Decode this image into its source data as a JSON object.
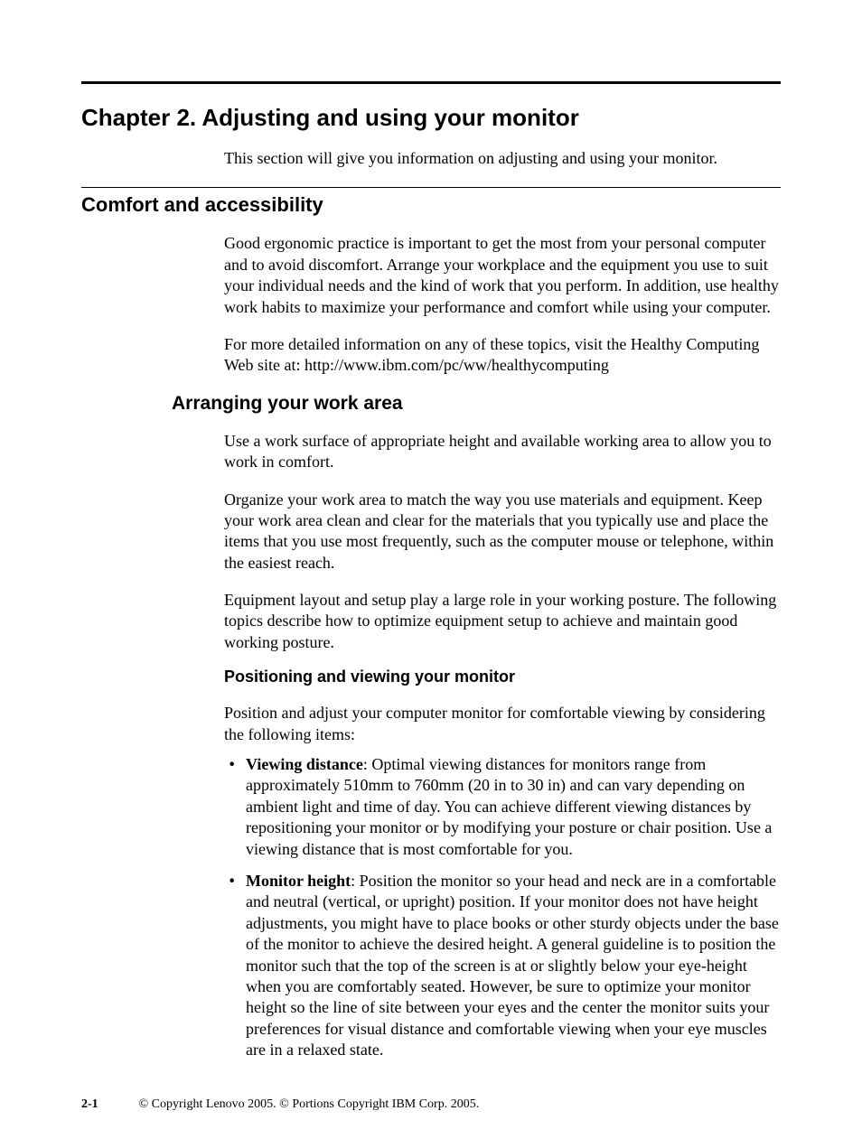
{
  "chapter": {
    "title": "Chapter 2. Adjusting and using your monitor",
    "intro": "This section will give you information on adjusting and using your monitor."
  },
  "section": {
    "heading": "Comfort and accessibility",
    "p1": "Good ergonomic practice is important to get the most from your personal computer and to avoid discomfort. Arrange your workplace and the equipment you use to suit your individual needs and the kind of work that you perform. In addition, use healthy work habits to maximize your performance and comfort while using your computer.",
    "p2": "For more detailed information on any of these topics, visit the Healthy Computing Web site at: http://www.ibm.com/pc/ww/healthycomputing"
  },
  "subsection": {
    "heading": "Arranging your work area",
    "p1": "Use a work surface of appropriate height and available working area to allow you to work in comfort.",
    "p2": "Organize your work area to match the way you use materials and equipment. Keep your work area clean and clear for the materials that you typically use and place the items that you use most frequently, such as the computer mouse or telephone, within the easiest reach.",
    "p3": "Equipment layout and setup play a large role in your working posture. The following topics describe how to optimize equipment setup to achieve and maintain good working posture."
  },
  "subsub": {
    "heading": "Positioning and viewing your monitor",
    "intro": "Position and adjust your computer monitor for comfortable viewing by considering the following items:",
    "bullets": [
      {
        "label": "Viewing distance",
        "text": ": Optimal viewing distances for monitors range from approximately 510mm to 760mm (20 in to 30 in) and can vary depending on ambient light and time of day. You can achieve different viewing distances by repositioning your monitor or by modifying your posture or chair position. Use a viewing distance that is most comfortable for you."
      },
      {
        "label": "Monitor height",
        "text": ": Position the monitor so your head and neck are in a comfortable and neutral (vertical, or upright) position. If your monitor does not have height adjustments, you might have to place books or other sturdy objects under the base of the monitor to achieve the desired height. A general guideline is to position the monitor such that the top of the screen is at or slightly below your eye-height when you are comfortably seated. However, be sure to optimize your monitor height so the line of site between your eyes and the center the monitor suits your preferences for visual distance and comfortable viewing when your eye muscles are in a relaxed state."
      }
    ]
  },
  "footer": {
    "pagenum": "2-1",
    "copyright": "© Copyright Lenovo 2005. © Portions Copyright IBM Corp. 2005."
  }
}
